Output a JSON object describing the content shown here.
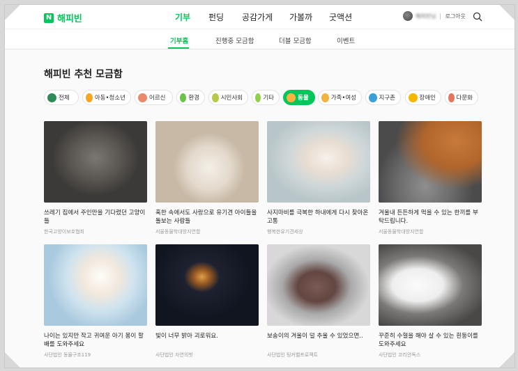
{
  "gnb": {
    "logo_mark": "N",
    "logo_text": "해피빈",
    "nav": [
      "기부",
      "펀딩",
      "공감가게",
      "가볼까",
      "굿액션"
    ],
    "user_name": "해피빈님",
    "logout": "로그아웃"
  },
  "lnb": {
    "items": [
      "기부홈",
      "진행중 모금함",
      "더블 모금함",
      "이벤트"
    ]
  },
  "section": {
    "title": "해피빈 추천 모금함"
  },
  "categories": [
    {
      "label": "전체",
      "icon": "leaf-icon",
      "color": "#2e8b57"
    },
    {
      "label": "아동•청소년",
      "icon": "child-icon",
      "color": "#f5a623"
    },
    {
      "label": "어르신",
      "icon": "elder-icon",
      "color": "#e98a6a"
    },
    {
      "label": "환경",
      "icon": "sprout-icon",
      "color": "#6cc24a"
    },
    {
      "label": "시민사회",
      "icon": "hands-icon",
      "color": "#b8c84a"
    },
    {
      "label": "기타",
      "icon": "dots-icon",
      "color": "#8ed14d"
    },
    {
      "label": "동물",
      "icon": "cat-icon",
      "color": "#f5a623",
      "active": true
    },
    {
      "label": "가족•여성",
      "icon": "family-icon",
      "color": "#f2b441"
    },
    {
      "label": "지구촌",
      "icon": "globe-icon",
      "color": "#3aa0d8"
    },
    {
      "label": "장애인",
      "icon": "wheelchair-icon",
      "color": "#f5b800"
    },
    {
      "label": "다문화",
      "icon": "heart-hands-icon",
      "color": "#e5755d"
    }
  ],
  "cards": [
    {
      "title": "쓰레기 집에서 주인만을 기다렸던 고양이들",
      "org": "한국고양이보호협회"
    },
    {
      "title": "혹한 속에서도 사랑으로 유기견 아이들을 돌보는 사람들",
      "org": "서울동물학대방지연합"
    },
    {
      "title": "사지마비를 극복한 하내에게 다시 찾아온 고통",
      "org": "행복한유기견세상"
    },
    {
      "title": "겨울내 든든하게 먹을 수 있는 한끼를 부탁드립니다.",
      "org": "서울동물학대방지연합"
    },
    {
      "title": "나이는 있지만 작고 귀여운 아기 몽이 할배를 도와주세요",
      "org": "사단법인 동물구조119"
    },
    {
      "title": "빛이 너무 밝아 괴로워요.",
      "org": "사단법인 자연의벗"
    },
    {
      "title": "보송이의 겨울이 덜 추울 수 있었으면..",
      "org": "사단법인 팅커벨프로젝트"
    },
    {
      "title": "꾸준히 수혈을 해야 살 수 있는 흰둥이를 도와주세요",
      "org": "사단법인 코리안독스"
    }
  ]
}
